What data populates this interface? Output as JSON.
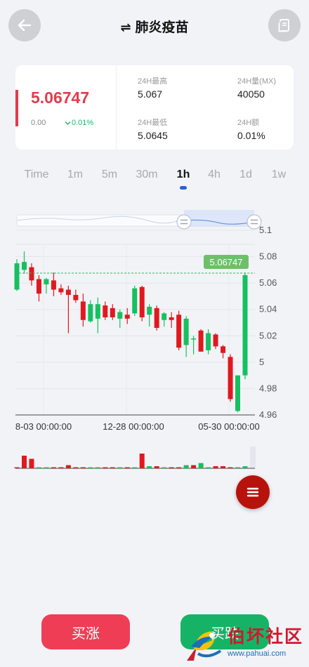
{
  "header": {
    "swap_icon": "⇌",
    "title": "肺炎疫苗"
  },
  "ticker": {
    "price": "5.06747",
    "change": "0.00",
    "change_pct": "0.01%",
    "high_label": "24H最高",
    "high_value": "5.067",
    "volume_label": "24H量(MX)",
    "volume_value": "40050",
    "low_label": "24H最低",
    "low_value": "5.0645",
    "amount_label": "24H额",
    "amount_value": "0.01%"
  },
  "tabs": [
    "Time",
    "1m",
    "5m",
    "30m",
    "1h",
    "4h",
    "1d",
    "1w"
  ],
  "active_tab": "1h",
  "chart_data": {
    "type": "candlestick",
    "y_ticks": [
      "5.1",
      "5.08",
      "5.06",
      "5.04",
      "5.02",
      "5",
      "4.98",
      "4.96"
    ],
    "ylim": [
      4.96,
      5.1
    ],
    "x_labels": [
      "8-03 00:00:00",
      "12-28 00:00:00",
      "05-30 00:00:00"
    ],
    "last_price_label": "5.06747",
    "last_price": 5.0675,
    "candles": [
      {
        "o": 5.055,
        "h": 5.078,
        "l": 5.054,
        "c": 5.075
      },
      {
        "o": 5.07,
        "h": 5.084,
        "l": 5.067,
        "c": 5.076
      },
      {
        "o": 5.072,
        "h": 5.075,
        "l": 5.058,
        "c": 5.062
      },
      {
        "o": 5.063,
        "h": 5.066,
        "l": 5.046,
        "c": 5.052
      },
      {
        "o": 5.059,
        "h": 5.064,
        "l": 5.052,
        "c": 5.063
      },
      {
        "o": 5.062,
        "h": 5.068,
        "l": 5.05,
        "c": 5.055
      },
      {
        "o": 5.056,
        "h": 5.059,
        "l": 5.051,
        "c": 5.053
      },
      {
        "o": 5.055,
        "h": 5.058,
        "l": 5.022,
        "c": 5.051
      },
      {
        "o": 5.051,
        "h": 5.055,
        "l": 5.045,
        "c": 5.047
      },
      {
        "o": 5.046,
        "h": 5.052,
        "l": 5.027,
        "c": 5.032
      },
      {
        "o": 5.031,
        "h": 5.047,
        "l": 5.03,
        "c": 5.044
      },
      {
        "o": 5.033,
        "h": 5.049,
        "l": 5.022,
        "c": 5.044
      },
      {
        "o": 5.043,
        "h": 5.046,
        "l": 5.032,
        "c": 5.034
      },
      {
        "o": 5.041,
        "h": 5.044,
        "l": 5.032,
        "c": 5.034
      },
      {
        "o": 5.033,
        "h": 5.04,
        "l": 5.026,
        "c": 5.038
      },
      {
        "o": 5.036,
        "h": 5.041,
        "l": 5.029,
        "c": 5.033
      },
      {
        "o": 5.037,
        "h": 5.058,
        "l": 5.035,
        "c": 5.056
      },
      {
        "o": 5.057,
        "h": 5.058,
        "l": 5.031,
        "c": 5.034
      },
      {
        "o": 5.036,
        "h": 5.044,
        "l": 5.027,
        "c": 5.042
      },
      {
        "o": 5.041,
        "h": 5.043,
        "l": 5.024,
        "c": 5.026
      },
      {
        "o": 5.032,
        "h": 5.038,
        "l": 5.027,
        "c": 5.037
      },
      {
        "o": 5.034,
        "h": 5.038,
        "l": 5.026,
        "c": 5.032
      },
      {
        "o": 5.036,
        "h": 5.039,
        "l": 5.009,
        "c": 5.011
      },
      {
        "o": 5.013,
        "h": 5.035,
        "l": 5.004,
        "c": 5.033
      },
      {
        "o": 5.018,
        "h": 5.02,
        "l": 5.006,
        "c": 5.018
      },
      {
        "o": 5.024,
        "h": 5.025,
        "l": 5.008,
        "c": 5.008
      },
      {
        "o": 5.009,
        "h": 5.025,
        "l": 5.006,
        "c": 5.022
      },
      {
        "o": 5.021,
        "h": 5.022,
        "l": 5.01,
        "c": 5.012
      },
      {
        "o": 5.012,
        "h": 5.013,
        "l": 5.003,
        "c": 5.007
      },
      {
        "o": 5.004,
        "h": 5.006,
        "l": 4.97,
        "c": 4.972
      },
      {
        "o": 4.963,
        "h": 4.99,
        "l": 4.962,
        "c": 4.99
      },
      {
        "o": 4.99,
        "h": 5.068,
        "l": 4.987,
        "c": 5.066
      }
    ],
    "volumes": [
      {
        "v": 0.05,
        "up": false
      },
      {
        "v": 0.6,
        "up": false
      },
      {
        "v": 0.45,
        "up": false
      },
      {
        "v": 0.05,
        "up": true
      },
      {
        "v": 0.05,
        "up": true
      },
      {
        "v": 0.05,
        "up": false
      },
      {
        "v": 0.05,
        "up": false
      },
      {
        "v": 0.15,
        "up": false
      },
      {
        "v": 0.05,
        "up": false
      },
      {
        "v": 0.05,
        "up": false
      },
      {
        "v": 0.05,
        "up": true
      },
      {
        "v": 0.05,
        "up": true
      },
      {
        "v": 0.05,
        "up": false
      },
      {
        "v": 0.05,
        "up": false
      },
      {
        "v": 0.05,
        "up": true
      },
      {
        "v": 0.05,
        "up": false
      },
      {
        "v": 0.05,
        "up": true
      },
      {
        "v": 0.7,
        "up": false
      },
      {
        "v": 0.1,
        "up": true
      },
      {
        "v": 0.1,
        "up": false
      },
      {
        "v": 0.05,
        "up": true
      },
      {
        "v": 0.05,
        "up": false
      },
      {
        "v": 0.05,
        "up": false
      },
      {
        "v": 0.15,
        "up": true
      },
      {
        "v": 0.15,
        "up": false
      },
      {
        "v": 0.25,
        "up": true
      },
      {
        "v": 0.05,
        "up": true
      },
      {
        "v": 0.1,
        "up": false
      },
      {
        "v": 0.1,
        "up": false
      },
      {
        "v": 0.05,
        "up": false
      },
      {
        "v": 0.05,
        "up": true
      },
      {
        "v": 0.1,
        "up": true
      }
    ]
  },
  "actions": {
    "buy_up": "买涨",
    "buy_down": "买跌"
  },
  "colors": {
    "up": "#16c060",
    "down": "#e0191f",
    "price_red": "#e03d4c",
    "accent_blue": "#2b5fd6"
  },
  "watermark": {
    "title": "伯坏社区",
    "url": "www.pahuai.com"
  }
}
